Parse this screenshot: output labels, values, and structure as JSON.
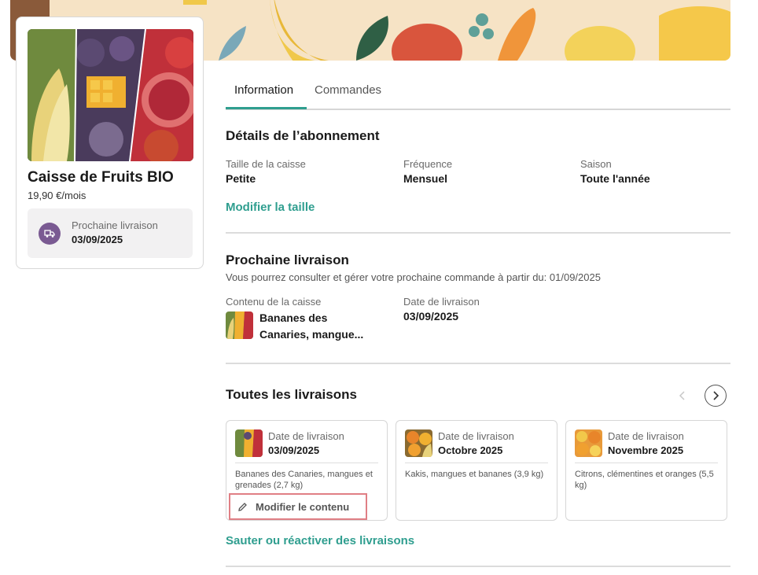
{
  "product": {
    "title": "Caisse de Fruits BIO",
    "price": "19,90 €/mois",
    "next_delivery_label": "Prochaine livraison",
    "next_delivery_date": "03/09/2025"
  },
  "tabs": [
    {
      "label": "Information",
      "active": true
    },
    {
      "label": "Commandes",
      "active": false
    }
  ],
  "subscription": {
    "heading": "Détails de l’abonnement",
    "fields": [
      {
        "label": "Taille de la caisse",
        "value": "Petite"
      },
      {
        "label": "Fréquence",
        "value": "Mensuel"
      },
      {
        "label": "Saison",
        "value": "Toute l'année"
      }
    ],
    "modify_link": "Modifier la taille"
  },
  "next_delivery": {
    "heading": "Prochaine livraison",
    "note": "Vous pourrez consulter et gérer votre prochaine commande à partir du: 01/09/2025",
    "content_label": "Contenu de la caisse",
    "content_value_line1": "Bananes des",
    "content_value_line2": "Canaries, mangue...",
    "date_label": "Date de livraison",
    "date_value": "03/09/2025"
  },
  "all_deliveries": {
    "heading": "Toutes les livraisons",
    "cards": [
      {
        "label": "Date de livraison",
        "date": "03/09/2025",
        "desc": "Bananes des Canaries, mangues et grenades (2,7 kg)",
        "edit_label": "Modifier le contenu"
      },
      {
        "label": "Date de livraison",
        "date": "Octobre 2025",
        "desc": "Kakis, mangues et bananes (3,9 kg)"
      },
      {
        "label": "Date de livraison",
        "date": "Novembre 2025",
        "desc": "Citrons, clémentines et oranges (5,5 kg)"
      }
    ],
    "skip_link": "Sauter ou réactiver des livraisons"
  },
  "colors": {
    "accent": "#2f9e8f",
    "truck_badge": "#7a5a92",
    "highlight_border": "#e07f85"
  }
}
